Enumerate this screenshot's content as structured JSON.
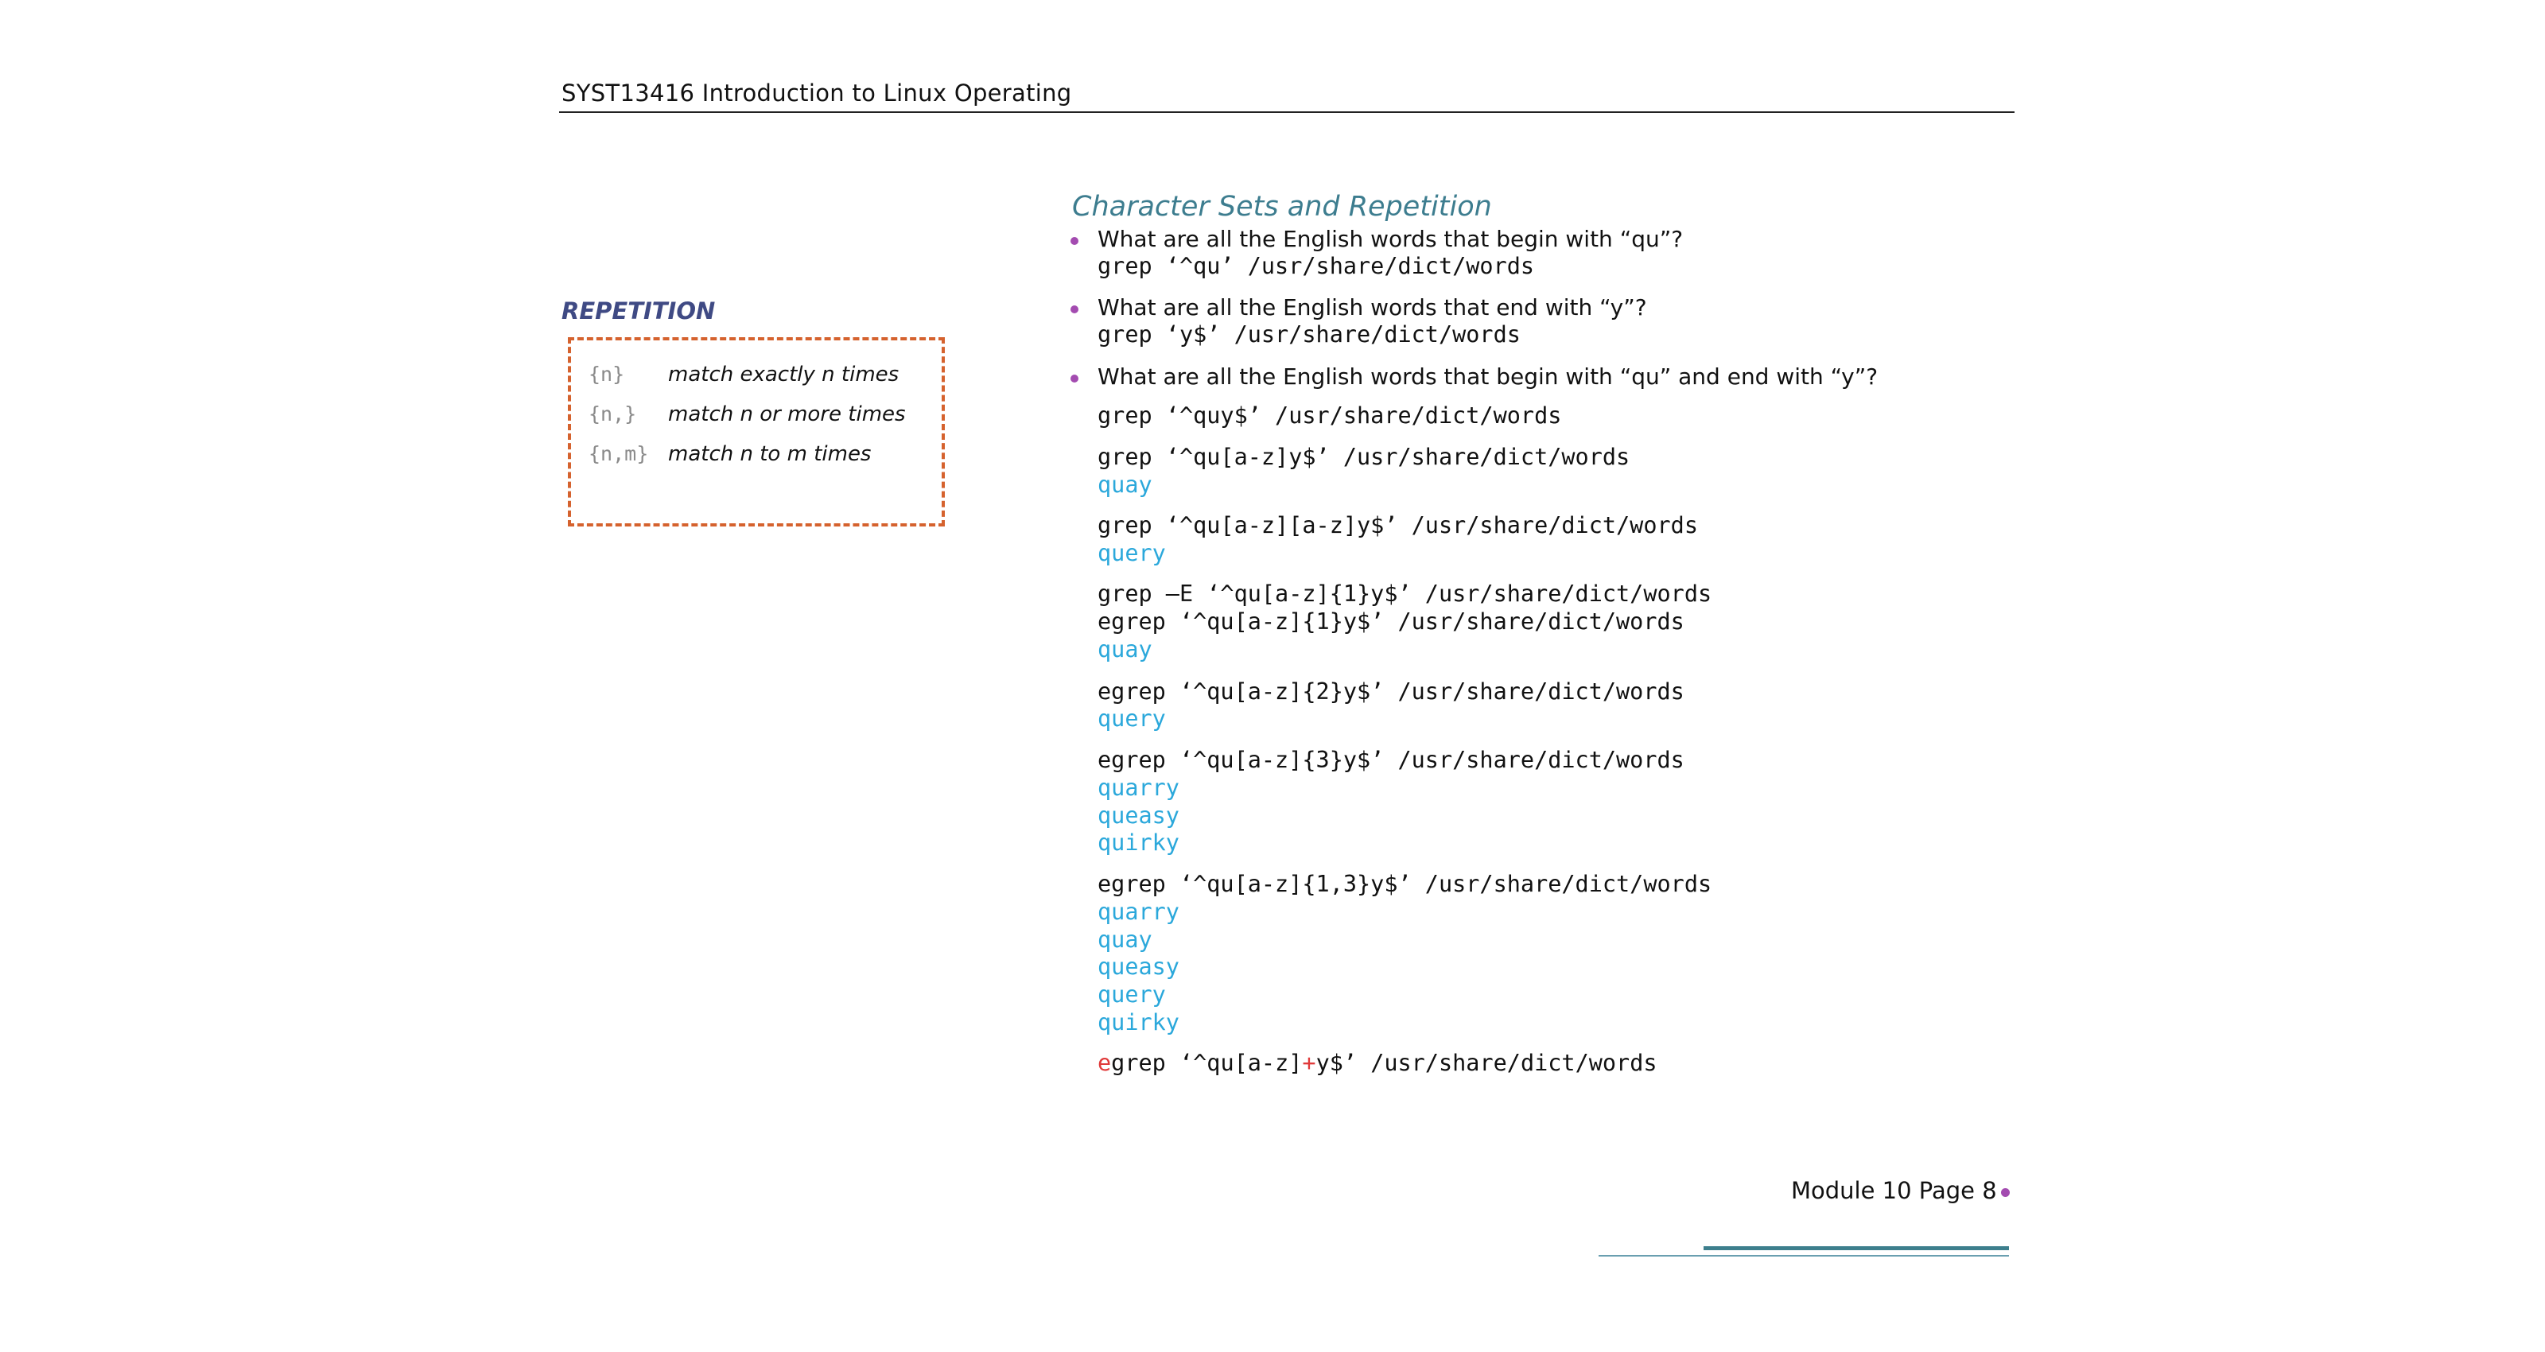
{
  "header": {
    "title": "SYST13416 Introduction to Linux Operating"
  },
  "sidebar": {
    "heading": "REPETITION",
    "rows": [
      {
        "code": "{n}",
        "desc": "match exactly n times"
      },
      {
        "code": "{n,}",
        "desc": "match n or more times"
      },
      {
        "code": "{n,m}",
        "desc": "match n to m times"
      }
    ]
  },
  "main": {
    "title": "Character Sets and Repetition",
    "q1": {
      "question": "What are all the English words that begin with “qu”?",
      "cmd": "grep ‘^qu’ /usr/share/dict/words"
    },
    "q2": {
      "question": "What are all the English words that end with “y”?",
      "cmd": "grep ‘y$’ /usr/share/dict/words"
    },
    "q3": {
      "question": "What are all the English words that begin with “qu” and end with “y”?",
      "cmd1": "grep ‘^quy$’ /usr/share/dict/words",
      "cmd2": "grep ‘^qu[a-z]y$’ /usr/share/dict/words",
      "out2": [
        "quay"
      ],
      "cmd3": "grep ‘^qu[a-z][a-z]y$’ /usr/share/dict/words",
      "out3": [
        "query"
      ],
      "cmd4a": "grep –E ‘^qu[a-z]{1}y$’ /usr/share/dict/words",
      "cmd4b": "egrep ‘^qu[a-z]{1}y$’ /usr/share/dict/words",
      "out4": [
        "quay"
      ],
      "cmd5": "egrep ‘^qu[a-z]{2}y$’ /usr/share/dict/words",
      "out5": [
        "query"
      ],
      "cmd6": "egrep ‘^qu[a-z]{3}y$’ /usr/share/dict/words",
      "out6": [
        "quarry",
        "queasy",
        "quirky"
      ],
      "cmd7": "egrep ‘^qu[a-z]{1,3}y$’ /usr/share/dict/words",
      "out7": [
        "quarry",
        "quay",
        "queasy",
        "query",
        "quirky"
      ],
      "cmd8": {
        "p1": "e",
        "p2": "grep ‘^qu[a-z]",
        "p3": "+",
        "p4": "y$’ /usr/share/dict/words"
      }
    }
  },
  "footer": {
    "page_label": "Module 10 Page 8"
  },
  "colors": {
    "accent_teal": "#3d7d8f",
    "output_blue": "#2ba8db",
    "bullet_purple": "#a34bb0",
    "box_orange": "#d5622e",
    "highlight_red": "#e03a3a"
  }
}
